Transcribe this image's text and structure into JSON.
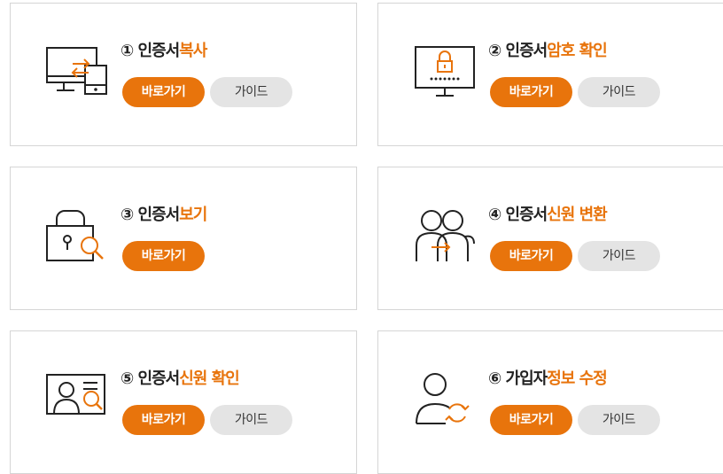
{
  "cards": [
    {
      "num": "①",
      "prefix": "인증서",
      "highlight": "복사",
      "go_label": "바로가기",
      "guide_label": "가이드"
    },
    {
      "num": "②",
      "prefix": "인증서",
      "highlight": "암호 확인",
      "go_label": "바로가기",
      "guide_label": "가이드"
    },
    {
      "num": "③",
      "prefix": "인증서",
      "highlight": "보기",
      "go_label": "바로가기"
    },
    {
      "num": "④",
      "prefix": "인증서",
      "highlight": "신원 변환",
      "go_label": "바로가기",
      "guide_label": "가이드"
    },
    {
      "num": "⑤",
      "prefix": "인증서",
      "highlight": "신원 확인",
      "go_label": "바로가기",
      "guide_label": "가이드"
    },
    {
      "num": "⑥",
      "prefix": "가입자",
      "highlight": "정보 수정",
      "go_label": "바로가기",
      "guide_label": "가이드"
    }
  ],
  "icons": [
    "computer-copy-icon",
    "monitor-lock-icon",
    "lock-search-icon",
    "users-convert-icon",
    "id-card-search-icon",
    "user-refresh-icon"
  ],
  "colors": {
    "accent": "#e8740c",
    "guide_bg": "#e4e4e4",
    "border": "#d5d5d5",
    "text": "#222222"
  }
}
